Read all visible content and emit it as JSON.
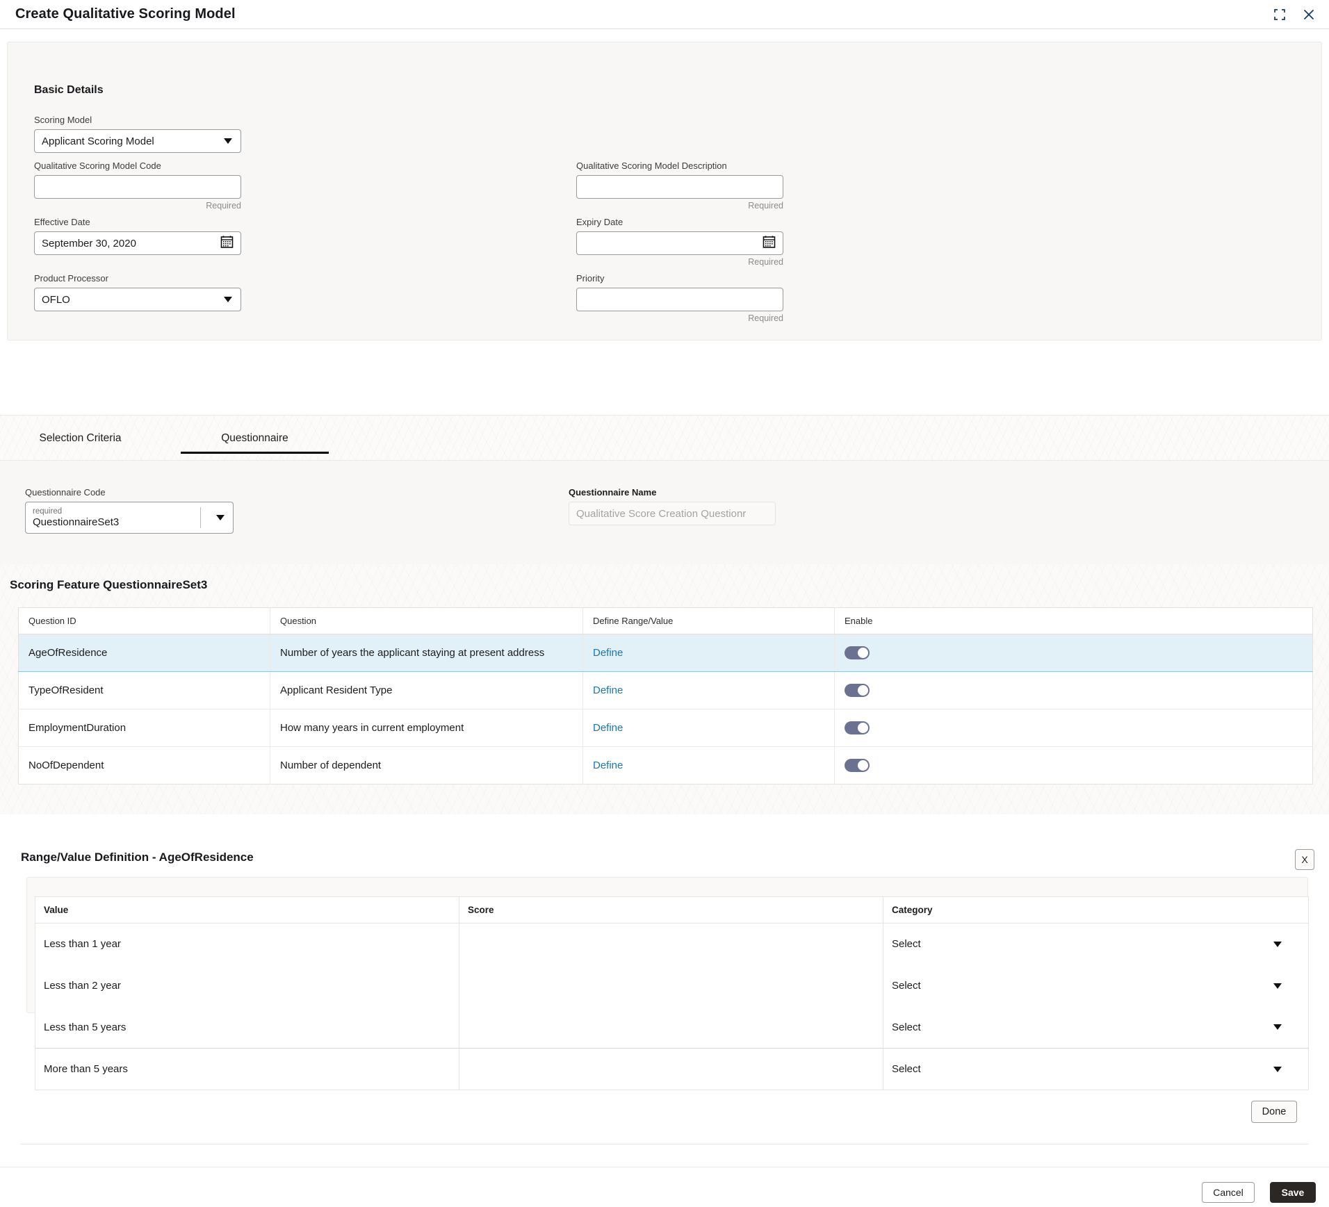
{
  "window": {
    "title": "Create Qualitative Scoring Model",
    "minimize_icon": "collapse-icon",
    "close_icon": "close-icon"
  },
  "basic_details": {
    "heading": "Basic Details",
    "scoring_model": {
      "label": "Scoring Model",
      "value": "Applicant Scoring Model",
      "caret_icon": "chevron-down-icon"
    },
    "model_code": {
      "label": "Qualitative Scoring Model Code",
      "value": "",
      "required_note": "Required"
    },
    "model_description": {
      "label": "Qualitative Scoring Model Description",
      "value": "",
      "required_note": "Required"
    },
    "effective_date": {
      "label": "Effective Date",
      "value": "September 30, 2020",
      "icon": "calendar-icon"
    },
    "expiry_date": {
      "label": "Expiry Date",
      "value": "",
      "required_note": "Required",
      "icon": "calendar-icon"
    },
    "product_processor": {
      "label": "Product Processor",
      "value": "OFLO",
      "caret_icon": "chevron-down-icon"
    },
    "priority": {
      "label": "Priority",
      "value": "",
      "required_note": "Required"
    }
  },
  "tabs": [
    {
      "label": "Selection Criteria",
      "active": false
    },
    {
      "label": "Questionnaire",
      "active": true
    }
  ],
  "questionnaire": {
    "code": {
      "label": "Questionnaire Code",
      "hint": "required",
      "value": "QuestionnaireSet3",
      "caret_icon": "chevron-down-icon"
    },
    "name": {
      "label": "Questionnaire Name",
      "value": "Qualitative Score Creation Questionr"
    }
  },
  "scoring_feature": {
    "title": "Scoring Feature QuestionnaireSet3",
    "columns": [
      "Question ID",
      "Question",
      "Define Range/Value",
      "Enable"
    ],
    "rows": [
      {
        "question_id": "AgeOfResidence",
        "question": "Number of years the applicant staying at present address",
        "define": "Define",
        "enabled": true,
        "selected": true
      },
      {
        "question_id": "TypeOfResident",
        "question": "Applicant Resident Type",
        "define": "Define",
        "enabled": true,
        "selected": false
      },
      {
        "question_id": "EmploymentDuration",
        "question": "How many years in current employment",
        "define": "Define",
        "enabled": true,
        "selected": false
      },
      {
        "question_id": "NoOfDependent",
        "question": "Number of dependent",
        "define": "Define",
        "enabled": true,
        "selected": false
      }
    ]
  },
  "range_definition": {
    "title": "Range/Value Definition - AgeOfResidence",
    "close_label": "X",
    "columns": [
      "Value",
      "Score",
      "Category"
    ],
    "rows": [
      {
        "value": "Less than 1 year",
        "score": "",
        "category": "Select"
      },
      {
        "value": "Less than 2 year",
        "score": "",
        "category": "Select"
      },
      {
        "value": "Less than 5 years",
        "score": "",
        "category": "Select"
      },
      {
        "value": "More than 5 years",
        "score": "",
        "category": "Select"
      }
    ],
    "done_label": "Done"
  },
  "footer": {
    "cancel_label": "Cancel",
    "save_label": "Save"
  },
  "colors": {
    "link": "#1778b5",
    "selected_row": "#e2f0f7",
    "toggle_on": "#6b7190",
    "save_bg": "#2b2724",
    "tab_underline": "#000000"
  }
}
